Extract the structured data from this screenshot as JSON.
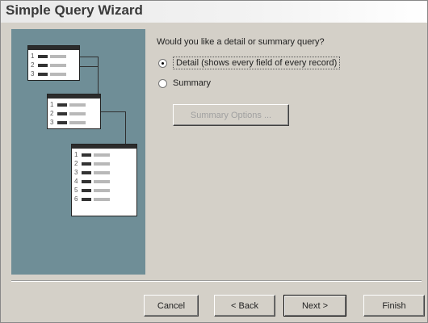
{
  "window": {
    "title": "Simple Query Wizard"
  },
  "question": "Would you like a detail or summary query?",
  "options": [
    {
      "label": "Detail (shows every field of every record)",
      "selected": true
    },
    {
      "label": "Summary",
      "selected": false
    }
  ],
  "summary_options_button": {
    "label": "Summary Options ...",
    "enabled": false
  },
  "buttons": {
    "cancel": "Cancel",
    "back": "< Back",
    "next": "Next >",
    "finish": "Finish"
  },
  "illustration": {
    "card_a": [
      {
        "n": "1"
      },
      {
        "n": "2"
      },
      {
        "n": "3"
      }
    ],
    "card_b": [
      {
        "n": "1"
      },
      {
        "n": "2"
      },
      {
        "n": "3"
      }
    ],
    "card_c": [
      {
        "n": "1"
      },
      {
        "n": "2"
      },
      {
        "n": "3"
      },
      {
        "n": "4"
      },
      {
        "n": "5"
      },
      {
        "n": "6"
      }
    ]
  },
  "colors": {
    "illustration_bg": "#6f8e97",
    "window_bg": "#d4d0c8"
  }
}
